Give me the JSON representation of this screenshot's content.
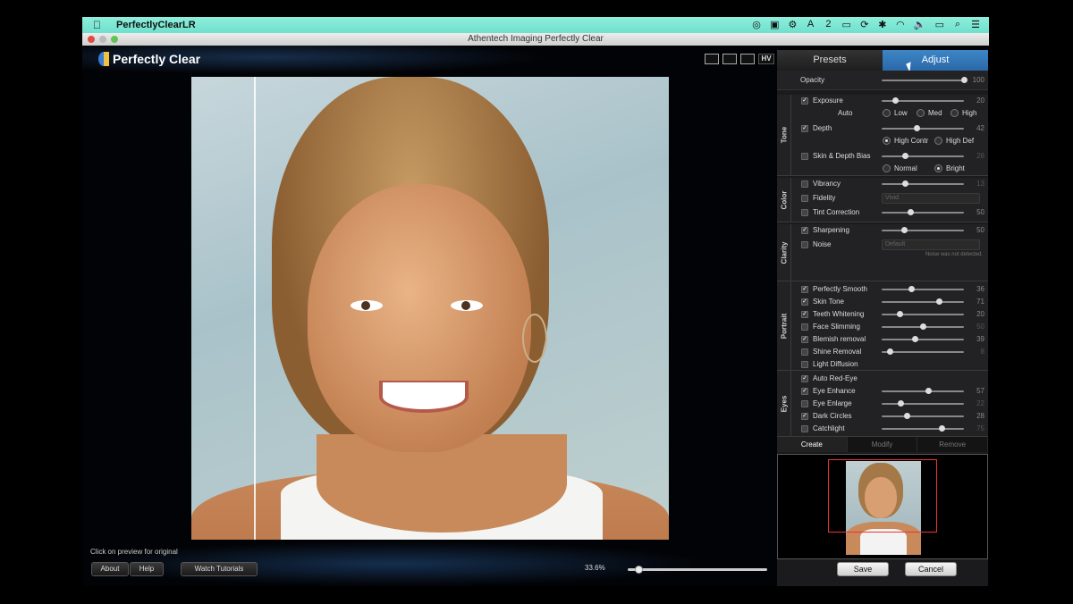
{
  "menubar": {
    "app_name": "PerfectlyClearLR",
    "tray_items": [
      "◎",
      "▣",
      "⚙",
      "A",
      "2",
      "▭",
      "⟳",
      "✱",
      "◠",
      "🔈",
      "▭",
      "⌕",
      "☰"
    ]
  },
  "window": {
    "title": "Athentech Imaging Perfectly Clear"
  },
  "brand": {
    "logo_text": "Perfectly Clear",
    "accent": "#2f74b8"
  },
  "view_modes": {
    "hv_label": "HV"
  },
  "preview_hint": "Click on preview for original",
  "bottom_buttons": {
    "about": "About",
    "help": "Help",
    "tutorials": "Watch Tutorials"
  },
  "zoom": {
    "label": "33.6%",
    "value": 0.05
  },
  "tabs": {
    "presets": "Presets",
    "adjust": "Adjust"
  },
  "opacity": {
    "label": "Opacity",
    "value": "100",
    "level": 1.0
  },
  "tone": {
    "group_label": "Tone",
    "exposure": {
      "label": "Exposure",
      "value": "20",
      "level": 0.16,
      "checked": true
    },
    "auto_label": "Auto",
    "auto_options": [
      "Low",
      "Med",
      "High"
    ],
    "depth": {
      "label": "Depth",
      "value": "42",
      "level": 0.42,
      "checked": true
    },
    "depth_options": [
      "High Contr",
      "High Def"
    ],
    "skin_bias": {
      "label": "Skin & Depth Bias",
      "value": "26",
      "level": 0.28,
      "checked": false
    },
    "bias_options": [
      "Normal",
      "Bright"
    ]
  },
  "color": {
    "group_label": "Color",
    "vibrancy": {
      "label": "Vibrancy",
      "value": "13",
      "level": 0.28
    },
    "fidelity": {
      "label": "Fidelity",
      "select_value": "Vivid"
    },
    "tint": {
      "label": "Tint Correction",
      "value": "50",
      "level": 0.35
    }
  },
  "clarity": {
    "group_label": "Clarity",
    "sharpening": {
      "label": "Sharpening",
      "value": "50",
      "level": 0.27,
      "checked": true
    },
    "noise": {
      "label": "Noise",
      "select_value": "Default"
    },
    "noise_note": "Noise was not detected."
  },
  "portrait": {
    "group_label": "Portrait",
    "items": [
      {
        "label": "Perfectly Smooth",
        "value": "36",
        "level": 0.36,
        "checked": true,
        "active": true
      },
      {
        "label": "Skin Tone",
        "value": "71",
        "level": 0.7,
        "checked": true,
        "active": true
      },
      {
        "label": "Teeth Whitening",
        "value": "20",
        "level": 0.22,
        "checked": true,
        "active": true
      },
      {
        "label": "Face Slimming",
        "value": "50",
        "level": 0.5,
        "checked": false,
        "active": false
      },
      {
        "label": "Blemish removal",
        "value": "39",
        "level": 0.4,
        "checked": true,
        "active": true
      },
      {
        "label": "Shine Removal",
        "value": "8",
        "level": 0.1,
        "checked": false,
        "active": false
      },
      {
        "label": "Light Diffusion",
        "value": "",
        "level": null,
        "checked": false,
        "active": false
      }
    ]
  },
  "eyes": {
    "group_label": "Eyes",
    "items": [
      {
        "label": "Auto Red-Eye",
        "value": "",
        "level": null,
        "checked": true,
        "active": true
      },
      {
        "label": "Eye Enhance",
        "value": "57",
        "level": 0.57,
        "checked": true,
        "active": true
      },
      {
        "label": "Eye Enlarge",
        "value": "22",
        "level": 0.23,
        "checked": false,
        "active": false
      },
      {
        "label": "Dark Circles",
        "value": "28",
        "level": 0.3,
        "checked": true,
        "active": true
      },
      {
        "label": "Catchlight",
        "value": "75",
        "level": 0.73,
        "checked": false,
        "active": false
      }
    ]
  },
  "preset_actions": {
    "create": "Create",
    "modify": "Modify",
    "remove": "Remove"
  },
  "dialog_buttons": {
    "save": "Save",
    "cancel": "Cancel"
  }
}
